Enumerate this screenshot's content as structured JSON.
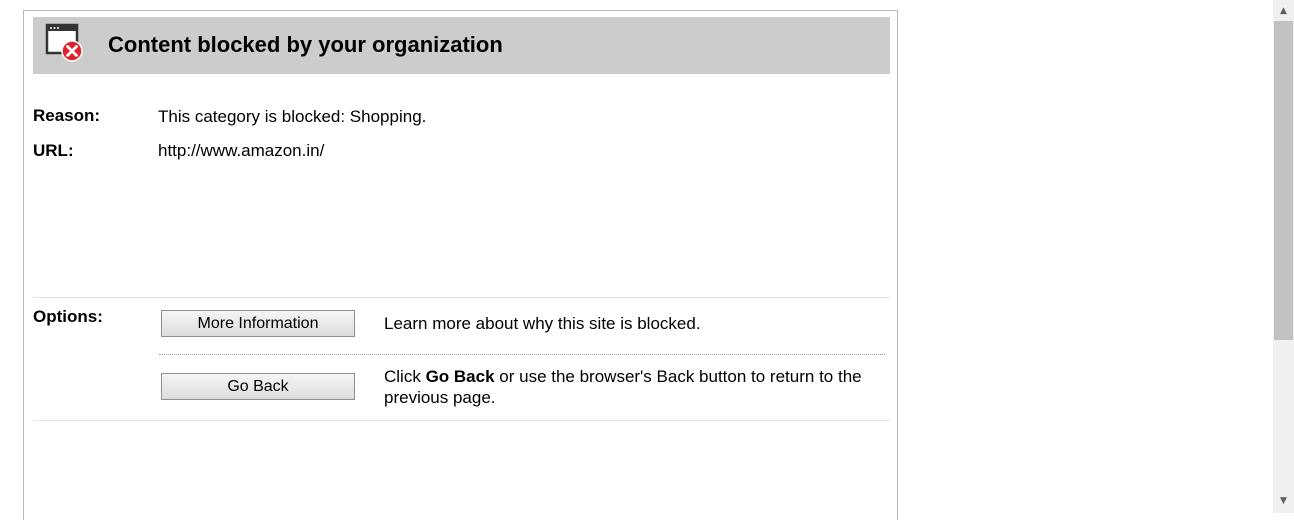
{
  "header": {
    "title": "Content blocked by your organization",
    "icon": "blocked-window-icon"
  },
  "details": {
    "reason_label": "Reason:",
    "reason_value": "This category is blocked: Shopping.",
    "url_label": "URL:",
    "url_value": "http://www.amazon.in/"
  },
  "options": {
    "label": "Options:",
    "more_info_button": "More Information",
    "more_info_desc": "Learn more about why this site is blocked.",
    "go_back_button": "Go Back",
    "go_back_desc_prefix": "Click ",
    "go_back_desc_bold": "Go Back",
    "go_back_desc_suffix": " or use the browser's Back button to return to the previous page."
  },
  "colors": {
    "header_bg": "#cccccc",
    "icon_badge": "#e0202a"
  }
}
